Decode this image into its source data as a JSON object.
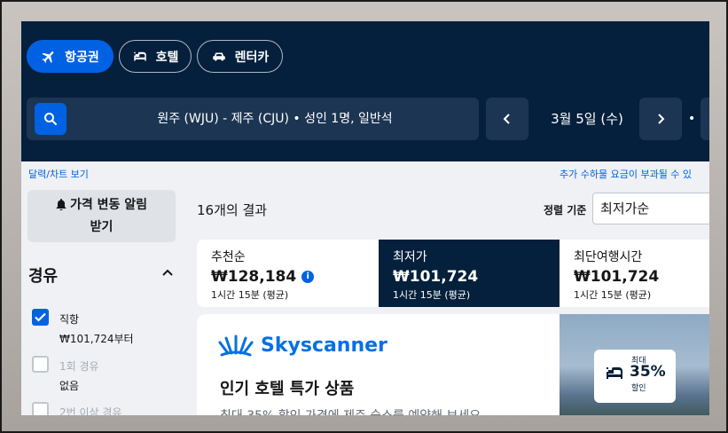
{
  "tabs": {
    "flights": "항공권",
    "hotels": "호텔",
    "cars": "렌터카"
  },
  "search": {
    "summary": "원주 (WJU) - 제주 (CJU)  •  성인 1명, 일반석",
    "date": "3월 5일 (수)",
    "separator": "•"
  },
  "links": {
    "calendar": "달력/차트 보기",
    "fees": "추가 수하물 요금이 부과될 수 있"
  },
  "sidebar": {
    "alert_line1": "가격 변동 알림",
    "alert_line2": "받기",
    "stops_title": "경유",
    "options": [
      {
        "label": "직항",
        "sub": "₩101,724부터",
        "checked": true
      },
      {
        "label": "1회 경유",
        "sub": "없음",
        "checked": false
      },
      {
        "label": "2번 이상 경유",
        "sub": "",
        "checked": false
      }
    ]
  },
  "main": {
    "result_count": "16개의 결과",
    "sort_label": "정렬 기준",
    "sort_value": "최저가순"
  },
  "sort_tabs": [
    {
      "title": "추천순",
      "price": "₩128,184",
      "duration": "1시간 15분 (평균)"
    },
    {
      "title": "최저가",
      "price": "₩101,724",
      "duration": "1시간 15분 (평균)"
    },
    {
      "title": "최단여행시간",
      "price": "₩101,724",
      "duration": "1시간 15분 (평균)"
    }
  ],
  "promo": {
    "brand": "Skyscanner",
    "title": "인기 호텔 특가 상품",
    "desc": "최대 35% 할인 가격에 제주 숙소를 예약해 보세요",
    "badge_top": "최대",
    "badge_pct": "35%",
    "badge_bottom": "할인"
  },
  "colors": {
    "header": "#05203c",
    "accent": "#0062e3"
  }
}
